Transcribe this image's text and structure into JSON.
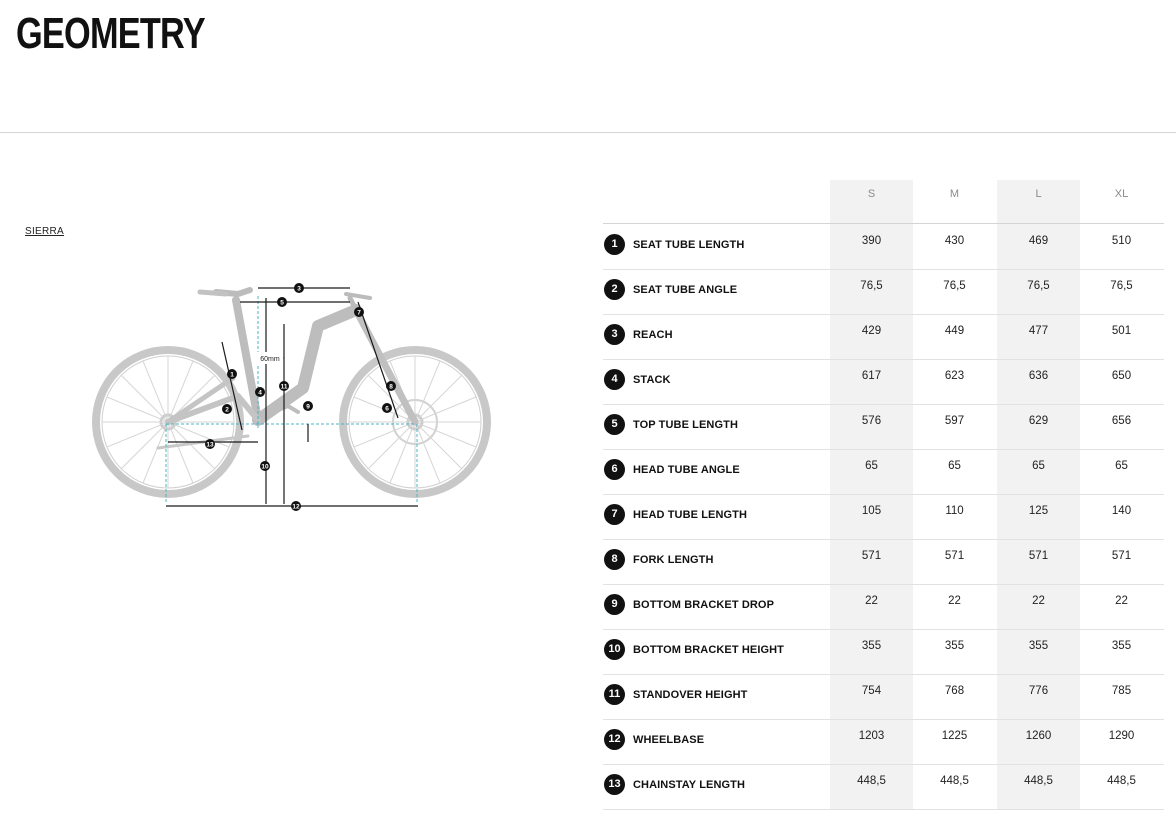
{
  "page": {
    "title": "GEOMETRY"
  },
  "model": {
    "name": "SIERRA"
  },
  "diagram": {
    "spacer_label": "60mm"
  },
  "table": {
    "sizes": [
      "S",
      "M",
      "L",
      "XL"
    ],
    "rows": [
      {
        "num": "1",
        "label": "SEAT TUBE LENGTH",
        "values": [
          "390",
          "430",
          "469",
          "510"
        ]
      },
      {
        "num": "2",
        "label": "SEAT TUBE ANGLE",
        "values": [
          "76,5",
          "76,5",
          "76,5",
          "76,5"
        ]
      },
      {
        "num": "3",
        "label": "REACH",
        "values": [
          "429",
          "449",
          "477",
          "501"
        ]
      },
      {
        "num": "4",
        "label": "STACK",
        "values": [
          "617",
          "623",
          "636",
          "650"
        ]
      },
      {
        "num": "5",
        "label": "TOP TUBE LENGTH",
        "values": [
          "576",
          "597",
          "629",
          "656"
        ]
      },
      {
        "num": "6",
        "label": "HEAD TUBE ANGLE",
        "values": [
          "65",
          "65",
          "65",
          "65"
        ]
      },
      {
        "num": "7",
        "label": "HEAD TUBE LENGTH",
        "values": [
          "105",
          "110",
          "125",
          "140"
        ]
      },
      {
        "num": "8",
        "label": "FORK LENGTH",
        "values": [
          "571",
          "571",
          "571",
          "571"
        ]
      },
      {
        "num": "9",
        "label": "BOTTOM BRACKET DROP",
        "values": [
          "22",
          "22",
          "22",
          "22"
        ]
      },
      {
        "num": "10",
        "label": "BOTTOM BRACKET HEIGHT",
        "values": [
          "355",
          "355",
          "355",
          "355"
        ]
      },
      {
        "num": "11",
        "label": "STANDOVER HEIGHT",
        "values": [
          "754",
          "768",
          "776",
          "785"
        ]
      },
      {
        "num": "12",
        "label": "WHEELBASE",
        "values": [
          "1203",
          "1225",
          "1260",
          "1290"
        ]
      },
      {
        "num": "13",
        "label": "CHAINSTAY LENGTH",
        "values": [
          "448,5",
          "448,5",
          "448,5",
          "448,5"
        ]
      }
    ]
  }
}
